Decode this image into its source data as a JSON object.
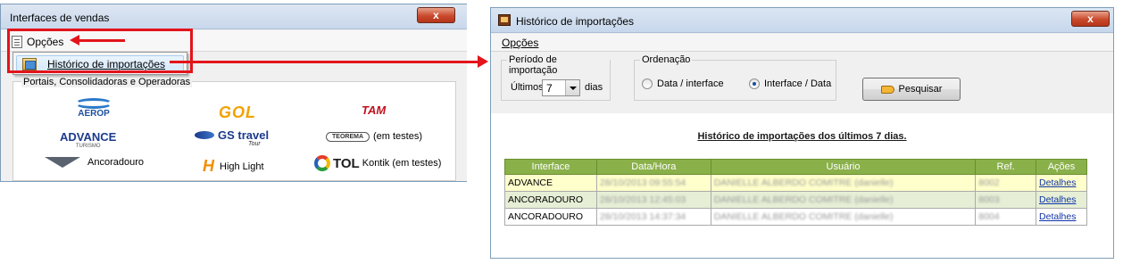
{
  "left_window": {
    "title": "Interfaces de vendas",
    "close_label": "x",
    "menu_opcoes": "Opções",
    "dropdown_item": "Histórico de importações",
    "group_label": "Portais, Consolidadoras e Operadoras",
    "logos": {
      "aerop": "AEROP",
      "gol": "GOL",
      "tam": "TAM",
      "advance": "ADVANCE",
      "advance_sub": "TURISMO",
      "gs_travel": "GS travel",
      "gs_sub": "Tour",
      "teorema": "TEOREMA",
      "teorema_note": "(em testes)",
      "ancoradouro": "Ancoradouro",
      "highlight": "High Light",
      "tol": "TOL",
      "tol_note": "Kontik (em testes)"
    }
  },
  "right_window": {
    "title": "Histórico de importações",
    "close_label": "x",
    "menu_opcoes": "Opções",
    "periodo": {
      "legend": "Período de importação",
      "prefix": "Últimos",
      "value": "7",
      "suffix": "dias"
    },
    "ordenacao": {
      "legend": "Ordenação",
      "option1": "Data / interface",
      "option2": "Interface / Data",
      "selected": "Interface / Data"
    },
    "search_button": "Pesquisar",
    "report_title": "Histórico de importações dos últimos 7 dias.",
    "table": {
      "headers": [
        "Interface",
        "Data/Hora",
        "Usuário",
        "Ref.",
        "Ações"
      ],
      "rows": [
        {
          "interface": "ADVANCE",
          "datahora": "28/10/2013 09:55:54",
          "usuario": "DANIELLE ALBERDO COMITRE (danielle)",
          "ref": "8002",
          "acao": "Detalhes"
        },
        {
          "interface": "ANCORADOURO",
          "datahora": "28/10/2013 12:45:03",
          "usuario": "DANIELLE ALBERDO COMITRE (danielle)",
          "ref": "8003",
          "acao": "Detalhes"
        },
        {
          "interface": "ANCORADOURO",
          "datahora": "28/10/2013 14:37:34",
          "usuario": "DANIELLE ALBERDO COMITRE (danielle)",
          "ref": "8004",
          "acao": "Detalhes"
        }
      ]
    }
  },
  "colors": {
    "highlight_red": "#e3141b",
    "header_green": "#8ab04a",
    "link_blue": "#1034a6"
  }
}
